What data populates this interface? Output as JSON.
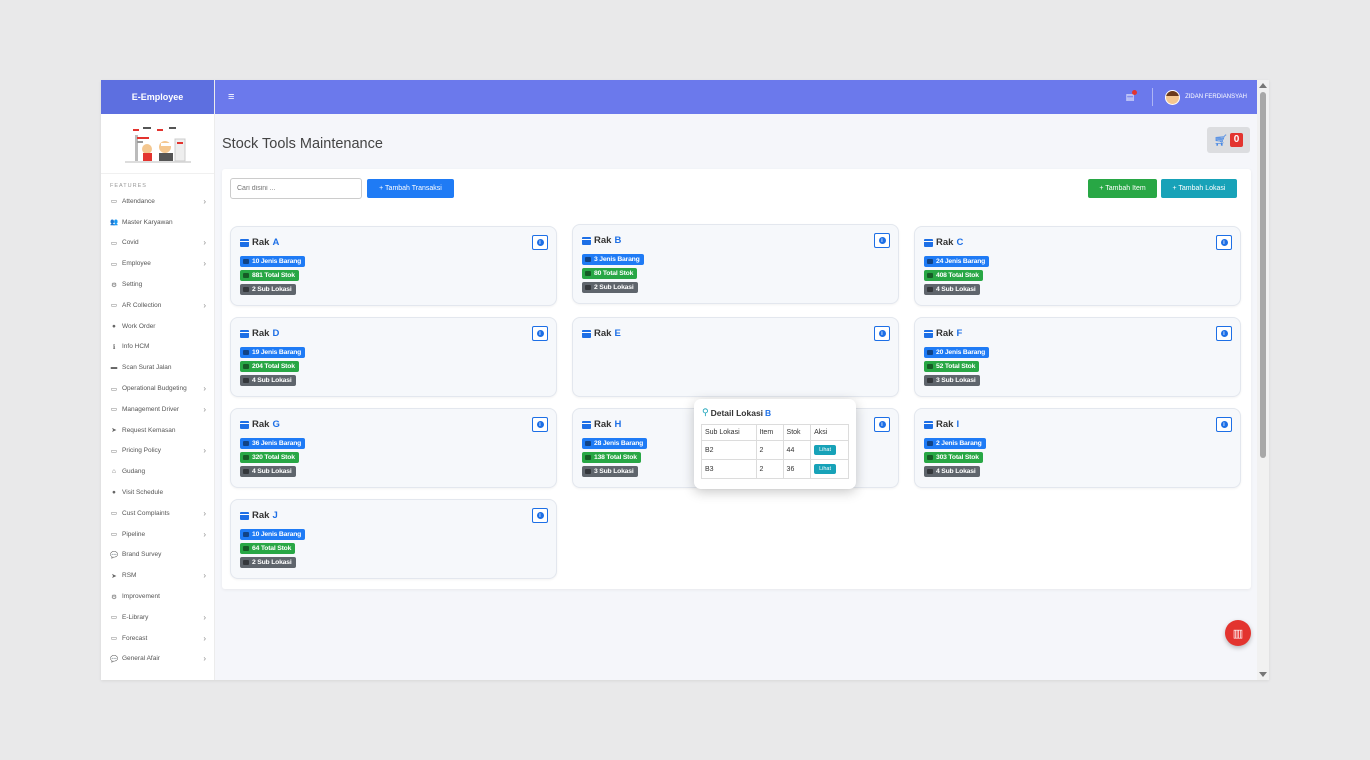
{
  "app": {
    "brand": "E-Employee"
  },
  "topbar": {
    "menu_icon": "≡",
    "user_name": "ZIDAN FERDIANSYAH"
  },
  "sidebar": {
    "features_title": "FEATURES",
    "items": [
      {
        "label": "Attendance",
        "icon": "calendar-icon",
        "glyph": "▭",
        "has_children": true
      },
      {
        "label": "Master Karyawan",
        "icon": "users-icon",
        "glyph": "👥",
        "has_children": false
      },
      {
        "label": "Covid",
        "icon": "calendar-icon",
        "glyph": "▭",
        "has_children": true
      },
      {
        "label": "Employee",
        "icon": "calendar-icon",
        "glyph": "▭",
        "has_children": true
      },
      {
        "label": "Setting",
        "icon": "cogs-icon",
        "glyph": "⚙",
        "has_children": false
      },
      {
        "label": "AR Collection",
        "icon": "calendar-icon",
        "glyph": "▭",
        "has_children": true
      },
      {
        "label": "Work Order",
        "icon": "circle-icon",
        "glyph": "●",
        "has_children": false
      },
      {
        "label": "Info HCM",
        "icon": "info-icon",
        "glyph": "ℹ",
        "has_children": false
      },
      {
        "label": "Scan Surat Jalan",
        "icon": "folder-icon",
        "glyph": "▬",
        "has_children": false
      },
      {
        "label": "Operational Budgeting",
        "icon": "calendar-icon",
        "glyph": "▭",
        "has_children": true
      },
      {
        "label": "Management Driver",
        "icon": "calendar-icon",
        "glyph": "▭",
        "has_children": true
      },
      {
        "label": "Request Kemasan",
        "icon": "paper-plane-icon",
        "glyph": "➤",
        "has_children": false
      },
      {
        "label": "Pricing Policy",
        "icon": "calendar-icon",
        "glyph": "▭",
        "has_children": true
      },
      {
        "label": "Gudang",
        "icon": "home-icon",
        "glyph": "⌂",
        "has_children": false
      },
      {
        "label": "Visit Schedule",
        "icon": "circle-icon",
        "glyph": "●",
        "has_children": false
      },
      {
        "label": "Cust Complaints",
        "icon": "folder-open-icon",
        "glyph": "▭",
        "has_children": true
      },
      {
        "label": "Pipeline",
        "icon": "calendar-icon",
        "glyph": "▭",
        "has_children": true
      },
      {
        "label": "Brand Survey",
        "icon": "comments-icon",
        "glyph": "💬",
        "has_children": false
      },
      {
        "label": "RSM",
        "icon": "paper-plane-icon",
        "glyph": "➤",
        "has_children": true
      },
      {
        "label": "Improvement",
        "icon": "cogs-icon",
        "glyph": "⚙",
        "has_children": false
      },
      {
        "label": "E-Library",
        "icon": "folder-open-icon",
        "glyph": "▭",
        "has_children": true
      },
      {
        "label": "Forecast",
        "icon": "folder-open-icon",
        "glyph": "▭",
        "has_children": true
      },
      {
        "label": "General Afair",
        "icon": "comments-icon",
        "glyph": "💬",
        "has_children": true
      }
    ]
  },
  "page": {
    "title": "Stock Tools Maintenance",
    "cart_count": "0",
    "search_placeholder": "Cari disini ...",
    "btn_transaksi": "+ Tambah Transaksi",
    "btn_item": "+ Tambah Item",
    "btn_lokasi": "+ Tambah Lokasi"
  },
  "racks": [
    {
      "prefix": "Rak",
      "name": "A",
      "jenis": "10 Jenis Barang",
      "stok": "881 Total Stok",
      "sub": "2 Sub Lokasi"
    },
    {
      "prefix": "Rak",
      "name": "B",
      "jenis": "3 Jenis Barang",
      "stok": "80 Total Stok",
      "sub": "2 Sub Lokasi"
    },
    {
      "prefix": "Rak",
      "name": "C",
      "jenis": "24 Jenis Barang",
      "stok": "408 Total Stok",
      "sub": "4 Sub Lokasi"
    },
    {
      "prefix": "Rak",
      "name": "D",
      "jenis": "19 Jenis Barang",
      "stok": "204 Total Stok",
      "sub": "4 Sub Lokasi"
    },
    {
      "prefix": "Rak",
      "name": "E",
      "jenis": "",
      "stok": "",
      "sub": ""
    },
    {
      "prefix": "Rak",
      "name": "F",
      "jenis": "20 Jenis Barang",
      "stok": "52 Total Stok",
      "sub": "3 Sub Lokasi"
    },
    {
      "prefix": "Rak",
      "name": "G",
      "jenis": "36 Jenis Barang",
      "stok": "320 Total Stok",
      "sub": "4 Sub Lokasi"
    },
    {
      "prefix": "Rak",
      "name": "H",
      "jenis": "28 Jenis Barang",
      "stok": "138 Total Stok",
      "sub": "3 Sub Lokasi"
    },
    {
      "prefix": "Rak",
      "name": "I",
      "jenis": "2 Jenis Barang",
      "stok": "303 Total Stok",
      "sub": "4 Sub Lokasi"
    },
    {
      "prefix": "Rak",
      "name": "J",
      "jenis": "10 Jenis Barang",
      "stok": "64 Total Stok",
      "sub": "2 Sub Lokasi"
    }
  ],
  "popover": {
    "title": "Detail Lokasi",
    "rack": "B",
    "headers": [
      "Sub Lokasi",
      "Item",
      "Stok",
      "Aksi"
    ],
    "rows": [
      {
        "sub": "B2",
        "item": "2",
        "stok": "44",
        "aksi": "Lihat"
      },
      {
        "sub": "B3",
        "item": "2",
        "stok": "36",
        "aksi": "Lihat"
      }
    ]
  },
  "colors": {
    "primary": "#1f7bf5",
    "success": "#28a745",
    "info": "#17a2b8",
    "danger": "#e3342f",
    "topbar": "#6b79ec",
    "brand": "#5d6fe0"
  }
}
